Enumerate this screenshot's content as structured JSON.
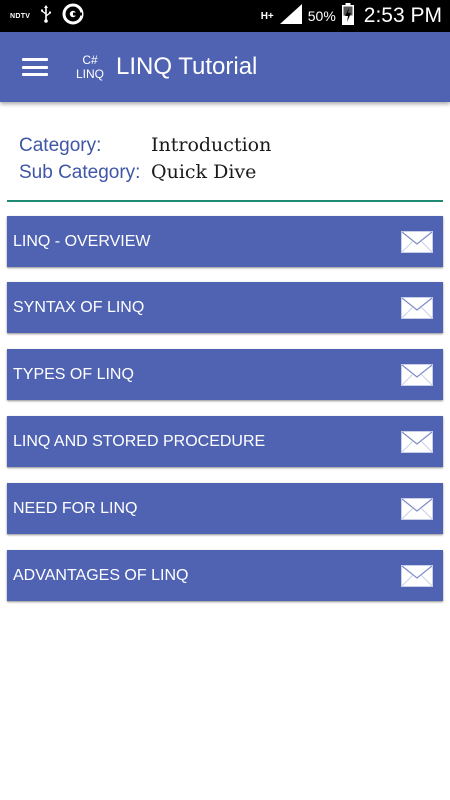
{
  "status_bar": {
    "ndtv": "NDTV",
    "network": "H+",
    "battery": "50%",
    "time": "2:53 PM"
  },
  "app_bar": {
    "logo_top": "C#",
    "logo_bottom": "LINQ",
    "title": "LINQ Tutorial"
  },
  "info": {
    "category_label": "Category:",
    "category_value": "Introduction",
    "subcategory_label": "Sub Category:",
    "subcategory_value": "Quick Dive"
  },
  "topics": [
    {
      "label": "LINQ - OVERVIEW"
    },
    {
      "label": "SYNTAX OF LINQ"
    },
    {
      "label": "TYPES OF LINQ"
    },
    {
      "label": "LINQ AND STORED PROCEDURE"
    },
    {
      "label": "NEED FOR LINQ"
    },
    {
      "label": "ADVANTAGES OF LINQ"
    }
  ],
  "colors": {
    "primary": "#5063b3",
    "label_blue": "#3f56a6",
    "divider": "#1f8a72"
  },
  "icons": {
    "menu": "hamburger-menu-icon",
    "topic": "envelope-icon"
  }
}
